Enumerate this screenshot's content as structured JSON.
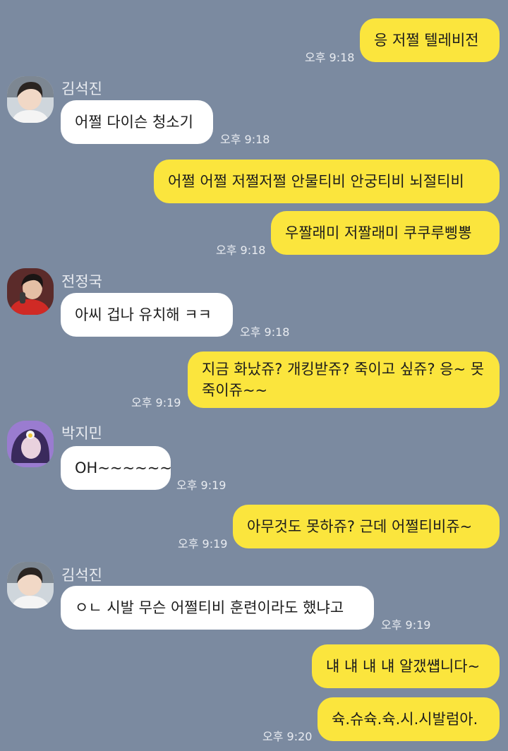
{
  "messages": [
    {
      "text": "응 저쩔 텔레비전",
      "time": "오후 9:18"
    },
    {
      "sender": "김석진",
      "text": "어쩔 다이슨 청소기",
      "time": "오후 9:18"
    },
    {
      "text": "어쩔 어쩔 저쩔저쩔 안물티비 안궁티비 뇌절티비"
    },
    {
      "text": "우짤래미 저짤래미 쿠쿠루삥뽕",
      "time": "오후 9:18"
    },
    {
      "sender": "전정국",
      "text": "아씨 겁나 유치해 ㅋㅋ",
      "time": "오후 9:18"
    },
    {
      "text": "지금 화났쥬? 개킹받쥬? 죽이고 싶쥬? 응~ 못죽이쥬~~",
      "time": "오후 9:19"
    },
    {
      "sender": "박지민",
      "text": "OH~~~~~~",
      "time": "오후 9:19"
    },
    {
      "text": "아무것도 못하쥬? 근데 어쩔티비쥬~",
      "time": "오후 9:19"
    },
    {
      "sender": "김석진",
      "text": "ㅇㄴ 시발 무슨 어쩔티비 훈련이라도 했냐고",
      "time": "오후 9:19"
    },
    {
      "text": "냬 냬 냬 냬 알갰썝니다~"
    },
    {
      "text": "슉.슈슉.슉.시.시발럼아.",
      "time": "오후 9:20"
    }
  ]
}
